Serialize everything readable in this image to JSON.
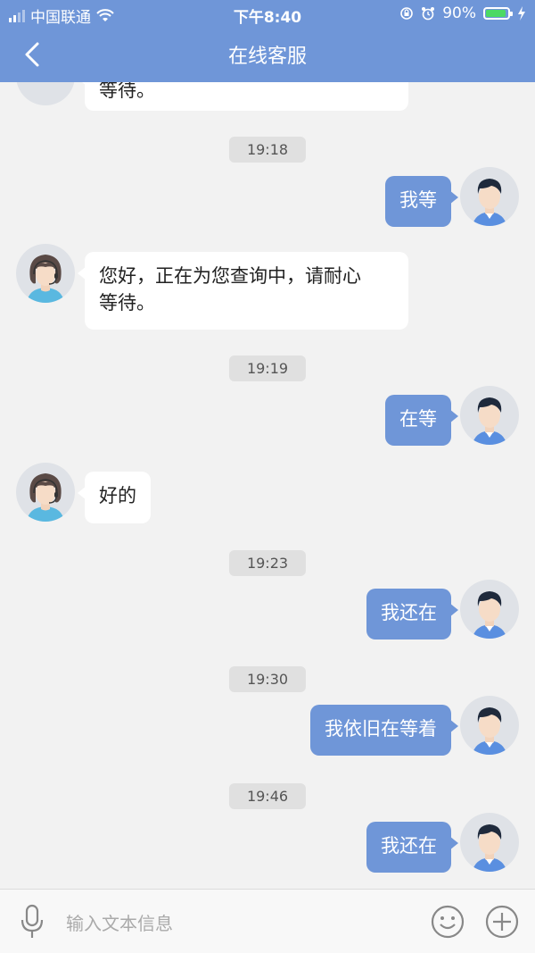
{
  "status_bar": {
    "carrier": "中国联通",
    "time": "下午8:40",
    "battery_percent": "90%",
    "battery_level": 0.9,
    "icons": [
      "signal-icon",
      "wifi-icon",
      "rotation-lock-icon",
      "alarm-icon",
      "battery-icon",
      "charging-icon"
    ]
  },
  "nav": {
    "title": "在线客服",
    "back_icon": "chevron-left-icon"
  },
  "chat": {
    "messages": [
      {
        "type": "message",
        "from": "agent",
        "lines": [
          "等待。"
        ]
      },
      {
        "type": "timestamp",
        "text": "19:18"
      },
      {
        "type": "message",
        "from": "user",
        "lines": [
          "我等"
        ]
      },
      {
        "type": "message",
        "from": "agent",
        "lines": [
          "您好，正在为您查询中，请耐心",
          "等待。"
        ]
      },
      {
        "type": "timestamp",
        "text": "19:19"
      },
      {
        "type": "message",
        "from": "user",
        "lines": [
          "在等"
        ]
      },
      {
        "type": "message",
        "from": "agent",
        "lines": [
          "好的"
        ]
      },
      {
        "type": "timestamp",
        "text": "19:23"
      },
      {
        "type": "message",
        "from": "user",
        "lines": [
          "我还在"
        ]
      },
      {
        "type": "timestamp",
        "text": "19:30"
      },
      {
        "type": "message",
        "from": "user",
        "lines": [
          "我依旧在等着"
        ]
      },
      {
        "type": "timestamp",
        "text": "19:46"
      },
      {
        "type": "message",
        "from": "user",
        "lines": [
          "我还在"
        ]
      }
    ]
  },
  "input_bar": {
    "placeholder": "输入文本信息",
    "mic_icon": "microphone-icon",
    "emoji_icon": "smiley-icon",
    "plus_icon": "plus-circle-icon"
  },
  "colors": {
    "accent": "#6f96d8",
    "background": "#f2f2f2",
    "agent_bubble": "#ffffff",
    "timestamp_bg": "#e0e0e0"
  }
}
